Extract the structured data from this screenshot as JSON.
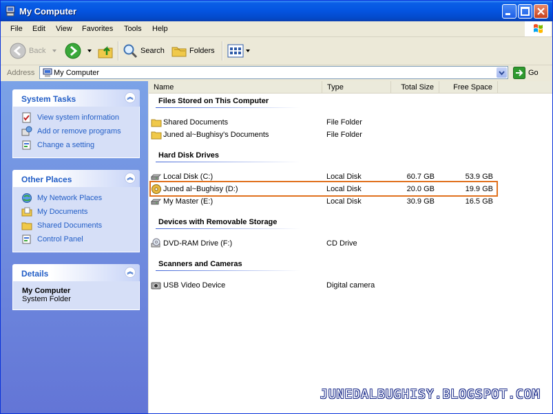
{
  "window": {
    "title": "My Computer"
  },
  "menu": [
    "File",
    "Edit",
    "View",
    "Favorites",
    "Tools",
    "Help"
  ],
  "toolbar": {
    "back": "Back",
    "search": "Search",
    "folders": "Folders"
  },
  "address": {
    "label": "Address",
    "value": "My Computer",
    "go": "Go"
  },
  "system_tasks": {
    "title": "System Tasks",
    "items": [
      {
        "label": "View system information",
        "icon": "system-info-icon"
      },
      {
        "label": "Add or remove programs",
        "icon": "add-remove-programs-icon"
      },
      {
        "label": "Change a setting",
        "icon": "control-panel-icon"
      }
    ]
  },
  "other_places": {
    "title": "Other Places",
    "items": [
      {
        "label": "My Network Places",
        "icon": "network-places-icon"
      },
      {
        "label": "My Documents",
        "icon": "my-documents-icon"
      },
      {
        "label": "Shared Documents",
        "icon": "folder-icon"
      },
      {
        "label": "Control Panel",
        "icon": "control-panel-icon"
      }
    ]
  },
  "details": {
    "title": "Details",
    "name": "My Computer",
    "type": "System Folder"
  },
  "columns": {
    "name": "Name",
    "type": "Type",
    "total_size": "Total Size",
    "free_space": "Free Space"
  },
  "groups": [
    {
      "title": "Files Stored on This Computer",
      "items": [
        {
          "name": "Shared Documents",
          "type": "File Folder",
          "total": "",
          "free": "",
          "icon": "folder-icon"
        },
        {
          "name": "Juned al~Bughisy's Documents",
          "type": "File Folder",
          "total": "",
          "free": "",
          "icon": "folder-icon"
        }
      ]
    },
    {
      "title": "Hard Disk Drives",
      "items": [
        {
          "name": "Local Disk (C:)",
          "type": "Local Disk",
          "total": "60.7 GB",
          "free": "53.9 GB",
          "icon": "hard-drive-icon"
        },
        {
          "name": "Juned al~Bughisy (D:)",
          "type": "Local Disk",
          "total": "20.0 GB",
          "free": "19.9 GB",
          "icon": "hard-drive-cd-icon"
        },
        {
          "name": "My Master (E:)",
          "type": "Local Disk",
          "total": "30.9 GB",
          "free": "16.5 GB",
          "icon": "hard-drive-icon"
        }
      ]
    },
    {
      "title": "Devices with Removable Storage",
      "items": [
        {
          "name": "DVD-RAM Drive (F:)",
          "type": "CD Drive",
          "total": "",
          "free": "",
          "icon": "dvd-drive-icon"
        }
      ]
    },
    {
      "title": "Scanners and Cameras",
      "items": [
        {
          "name": "USB Video Device",
          "type": "Digital camera",
          "total": "",
          "free": "",
          "icon": "camera-icon"
        }
      ]
    }
  ],
  "watermark": "JUNEDALBUGHISY.BLOGSPOT.COM",
  "colors": {
    "title_bar": "#0454e0",
    "task_pane": "#6f8fe0",
    "link": "#215dc6",
    "highlight": "#e0701c"
  }
}
